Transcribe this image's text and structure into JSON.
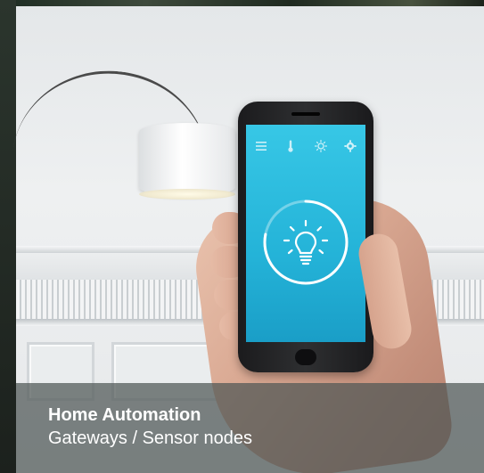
{
  "card": {
    "title": "Home Automation",
    "subtitle": "Gateways / Sensor nodes"
  },
  "phone_app": {
    "toolbar_icons": [
      "menu-icon",
      "thermometer-icon",
      "brightness-icon",
      "gear-icon"
    ],
    "center_icon": "lightbulb-icon",
    "brightness_ring_level": 0.78
  },
  "colors": {
    "screen": "#2bbde0",
    "caption_overlay": "#4e5654",
    "caption_text": "#ffffff"
  }
}
